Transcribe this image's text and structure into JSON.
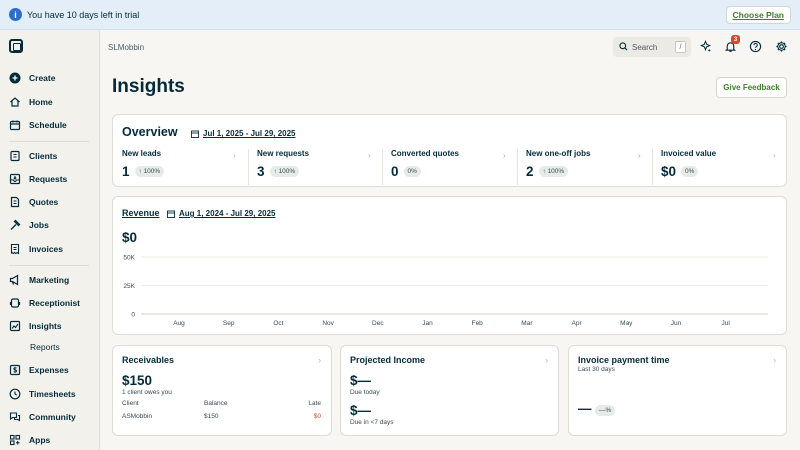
{
  "trial": {
    "message": "You have 10 days left in trial",
    "cta": "Choose Plan"
  },
  "sidebar": {
    "items": [
      {
        "label": "Create",
        "icon": "plus-circle-icon"
      },
      {
        "label": "Home",
        "icon": "home-icon"
      },
      {
        "label": "Schedule",
        "icon": "calendar-icon"
      },
      {
        "label": "Clients",
        "icon": "clients-icon"
      },
      {
        "label": "Requests",
        "icon": "inbox-icon"
      },
      {
        "label": "Quotes",
        "icon": "quote-icon"
      },
      {
        "label": "Jobs",
        "icon": "hammer-icon"
      },
      {
        "label": "Invoices",
        "icon": "invoice-icon"
      },
      {
        "label": "Marketing",
        "icon": "megaphone-icon"
      },
      {
        "label": "Receptionist",
        "icon": "receptionist-icon"
      },
      {
        "label": "Insights",
        "icon": "chart-icon"
      },
      {
        "label": "Reports",
        "icon": ""
      },
      {
        "label": "Expenses",
        "icon": "dollar-icon"
      },
      {
        "label": "Timesheets",
        "icon": "clock-icon"
      },
      {
        "label": "Community",
        "icon": "chat-icon"
      },
      {
        "label": "Apps",
        "icon": "apps-icon"
      }
    ]
  },
  "topbar": {
    "company": "SLMobbin",
    "search_placeholder": "Search",
    "search_shortcut": "/",
    "notification_count": "3"
  },
  "page": {
    "title": "Insights",
    "feedback": "Give Feedback"
  },
  "overview": {
    "title": "Overview",
    "date_range": "Jul 1, 2025 - Jul 29, 2025",
    "metrics": [
      {
        "label": "New leads",
        "value": "1",
        "change": "↑ 100%"
      },
      {
        "label": "New requests",
        "value": "3",
        "change": "↑ 100%"
      },
      {
        "label": "Converted quotes",
        "value": "0",
        "change": "0%"
      },
      {
        "label": "New one-off jobs",
        "value": "2",
        "change": "↑ 100%"
      },
      {
        "label": "Invoiced value",
        "value": "$0",
        "change": "0%"
      }
    ]
  },
  "revenue": {
    "title": "Revenue",
    "date_range": "Aug 1, 2024 - Jul 29, 2025",
    "total": "$0"
  },
  "chart_data": {
    "type": "line",
    "categories": [
      "Aug",
      "Sep",
      "Oct",
      "Nov",
      "Dec",
      "Jan",
      "Feb",
      "Mar",
      "Apr",
      "May",
      "Jun",
      "Jul"
    ],
    "values": [
      0,
      0,
      0,
      0,
      0,
      0,
      0,
      0,
      0,
      0,
      0,
      0
    ],
    "ylim": [
      0,
      50000
    ],
    "yticks": [
      0,
      25000,
      50000
    ],
    "ytick_labels": [
      "0",
      "25K",
      "50K"
    ],
    "grid": true,
    "title": "",
    "xlabel": "",
    "ylabel": ""
  },
  "receivables": {
    "title": "Receivables",
    "amount": "$150",
    "subtitle": "1 client owes you",
    "columns": [
      "Client",
      "Balance",
      "Late"
    ],
    "rows": [
      {
        "client": "ASMobbin",
        "balance": "$150",
        "late": "$0"
      }
    ]
  },
  "projected": {
    "title": "Projected Income",
    "due_today_value": "$—",
    "due_today_label": "Due today",
    "due_week_value": "$—",
    "due_week_label": "Due in <7 days"
  },
  "payment_time": {
    "title": "Invoice payment time",
    "subtitle": "Last 30 days",
    "value": "—",
    "change": "—%"
  },
  "chevron": "›",
  "colors": {
    "accent_green": "#3f7d28",
    "dark_text": "#032b3a",
    "alert_red": "#d34a2c",
    "trial_bg": "#e3eef8"
  }
}
